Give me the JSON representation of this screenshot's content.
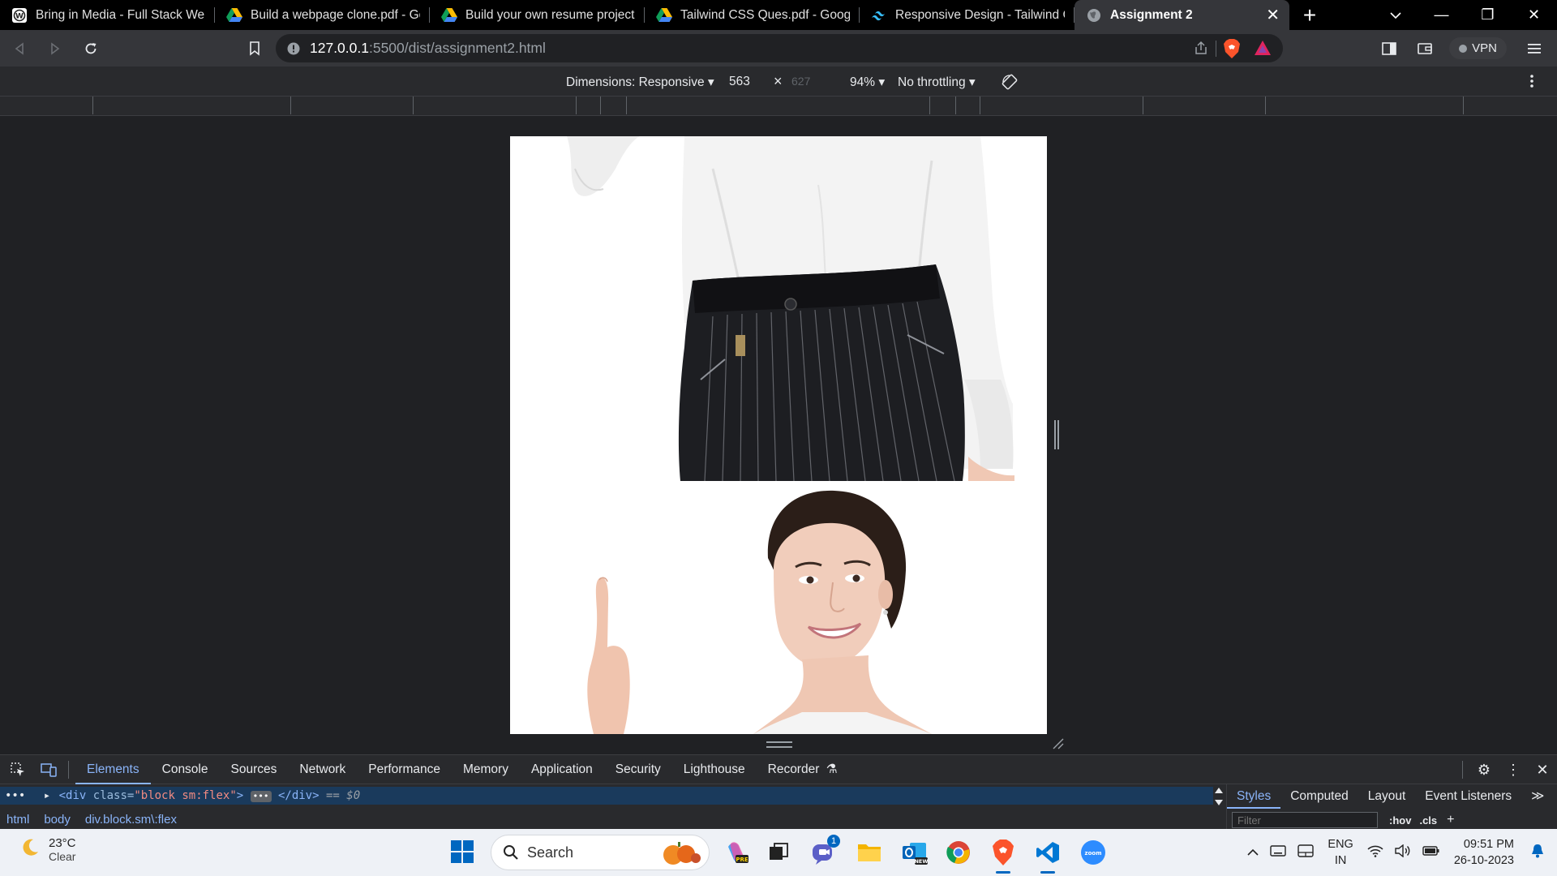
{
  "browser": {
    "tabs": [
      {
        "title": "Bring in Media - Full Stack Web D",
        "icon": "wordpress-icon",
        "active": false
      },
      {
        "title": "Build a webpage clone.pdf - Goo",
        "icon": "google-drive-icon",
        "active": false
      },
      {
        "title": "Build your own resume project.p",
        "icon": "google-drive-icon",
        "active": false
      },
      {
        "title": "Tailwind CSS Ques.pdf - Google I",
        "icon": "google-drive-icon",
        "active": false
      },
      {
        "title": "Responsive Design - Tailwind CSS",
        "icon": "tailwind-icon",
        "active": false
      },
      {
        "title": "Assignment 2",
        "icon": "globe-icon",
        "active": true
      }
    ],
    "new_tab": "+",
    "window_controls": {
      "minimize": "—",
      "restore": "❐",
      "close": "✕"
    },
    "url_host": "127.0.0.1",
    "url_path": ":5500/dist/assignment2.html",
    "vpn_label": "VPN"
  },
  "device_toolbar": {
    "dimensions_label": "Dimensions: Responsive",
    "width_value": "563",
    "times": "×",
    "height_placeholder": "627",
    "zoom": "94%",
    "throttling": "No throttling"
  },
  "devtools": {
    "tabs": [
      "Elements",
      "Console",
      "Sources",
      "Network",
      "Performance",
      "Memory",
      "Application",
      "Security",
      "Lighthouse",
      "Recorder"
    ],
    "active_tab": "Elements",
    "dom_line": {
      "dots": "•••",
      "open_tag": "<div",
      "attr_name": "class=",
      "attr_value": "\"block sm:flex\"",
      "close_open": ">",
      "ellipsis": "•••",
      "close_tag": "</div>",
      "eq": "== $0"
    },
    "breadcrumbs": [
      "html",
      "body",
      "div.block.sm\\:flex"
    ],
    "styles_tabs": [
      "Styles",
      "Computed",
      "Layout",
      "Event Listeners",
      "≫"
    ],
    "filter_placeholder": "Filter",
    "hov": ":hov",
    "cls": ".cls"
  },
  "taskbar": {
    "temperature": "23°C",
    "condition": "Clear",
    "search_label": "Search",
    "language": "ENG",
    "region": "IN",
    "time": "09:51 PM",
    "date": "26-10-2023",
    "chat_badge": "1"
  },
  "colors": {
    "accent": "#8ab4f8",
    "selection": "#1a3a5c",
    "brave": "#fb542b",
    "windows_blue": "#0067c0"
  }
}
